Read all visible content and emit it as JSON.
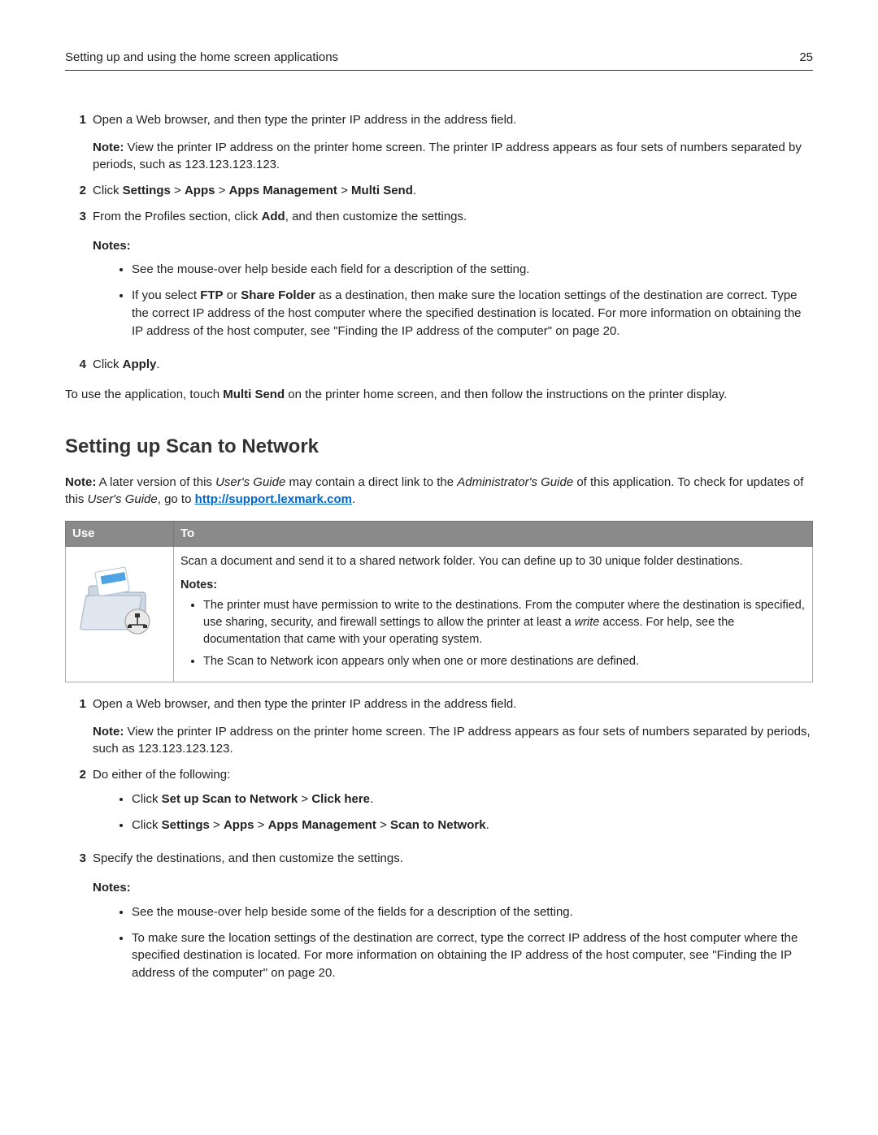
{
  "header": {
    "title": "Setting up and using the home screen applications",
    "page": "25"
  },
  "steps1": {
    "s1": {
      "num": "1",
      "text": "Open a Web browser, and then type the printer IP address in the address field.",
      "note_label": "Note:",
      "note_text": " View the printer IP address on the printer home screen. The printer IP address appears as four sets of numbers separated by periods, such as 123.123.123.123."
    },
    "s2": {
      "num": "2",
      "prefix": "Click ",
      "b1": "Settings",
      "sep": " > ",
      "b2": "Apps",
      "b3": "Apps Management",
      "b4": "Multi Send",
      "end": "."
    },
    "s3": {
      "num": "3",
      "t1": "From the Profiles section, click ",
      "b1": "Add",
      "t2": ", and then customize the settings.",
      "notes_label": "Notes:",
      "bullet1": "See the mouse-over help beside each field for a description of the setting.",
      "b2_p1": "If you select ",
      "b2_b1": "FTP",
      "b2_p2": " or ",
      "b2_b2": "Share Folder",
      "b2_p3": " as a destination, then make sure the location settings of the destination are correct. Type the correct IP address of the host computer where the specified destination is located. For more information on obtaining the IP address of the host computer, see \"Finding the IP address of the computer\" on page 20."
    },
    "s4": {
      "num": "4",
      "t1": "Click ",
      "b1": "Apply",
      "t2": "."
    }
  },
  "post1": {
    "p1": "To use the application, touch ",
    "b1": "Multi Send",
    "p2": " on the printer home screen, and then follow the instructions on the printer display."
  },
  "section2": {
    "heading": "Setting up Scan to Network",
    "note_label": "Note:",
    "note_p1": " A later version of this ",
    "note_i1": "User's Guide",
    "note_p2": " may contain a direct link to the ",
    "note_i2": "Administrator's Guide",
    "note_p3": " of this application. To check for updates of this ",
    "note_i3": "User's Guide",
    "note_p4": ", go to ",
    "link_text": "http://support.lexmark.com",
    "note_p5": "."
  },
  "table": {
    "h1": "Use",
    "h2": "To",
    "desc": "Scan a document and send it to a shared network folder. You can define up to 30 unique folder destinations.",
    "notes_label": "Notes:",
    "bul1_p1": "The printer must have permission to write to the destinations. From the computer where the destination is specified, use sharing, security, and firewall settings to allow the printer at least a ",
    "bul1_i1": "write",
    "bul1_p2": " access. For help, see the documentation that came with your operating system.",
    "bul2": "The Scan to Network icon appears only when one or more destinations are defined."
  },
  "steps2": {
    "s1": {
      "num": "1",
      "text": "Open a Web browser, and then type the printer IP address in the address field.",
      "note_label": "Note:",
      "note_text": " View the printer IP address on the printer home screen. The IP address appears as four sets of numbers separated by periods, such as 123.123.123.123."
    },
    "s2": {
      "num": "2",
      "text": "Do either of the following:",
      "b1_p1": "Click ",
      "b1_b1": "Set up Scan to Network",
      "b1_sep": " > ",
      "b1_b2": "Click here",
      "b1_end": ".",
      "b2_p1": "Click ",
      "b2_b1": "Settings",
      "b2_b2": "Apps",
      "b2_b3": "Apps Management",
      "b2_b4": "Scan to Network",
      "b2_end": "."
    },
    "s3": {
      "num": "3",
      "text": "Specify the destinations, and then customize the settings.",
      "notes_label": "Notes:",
      "bul1": "See the mouse-over help beside some of the fields for a description of the setting.",
      "bul2": "To make sure the location settings of the destination are correct, type the correct IP address of the host computer where the specified destination is located. For more information on obtaining the IP address of the host computer, see \"Finding the IP address of the computer\" on page 20."
    }
  }
}
